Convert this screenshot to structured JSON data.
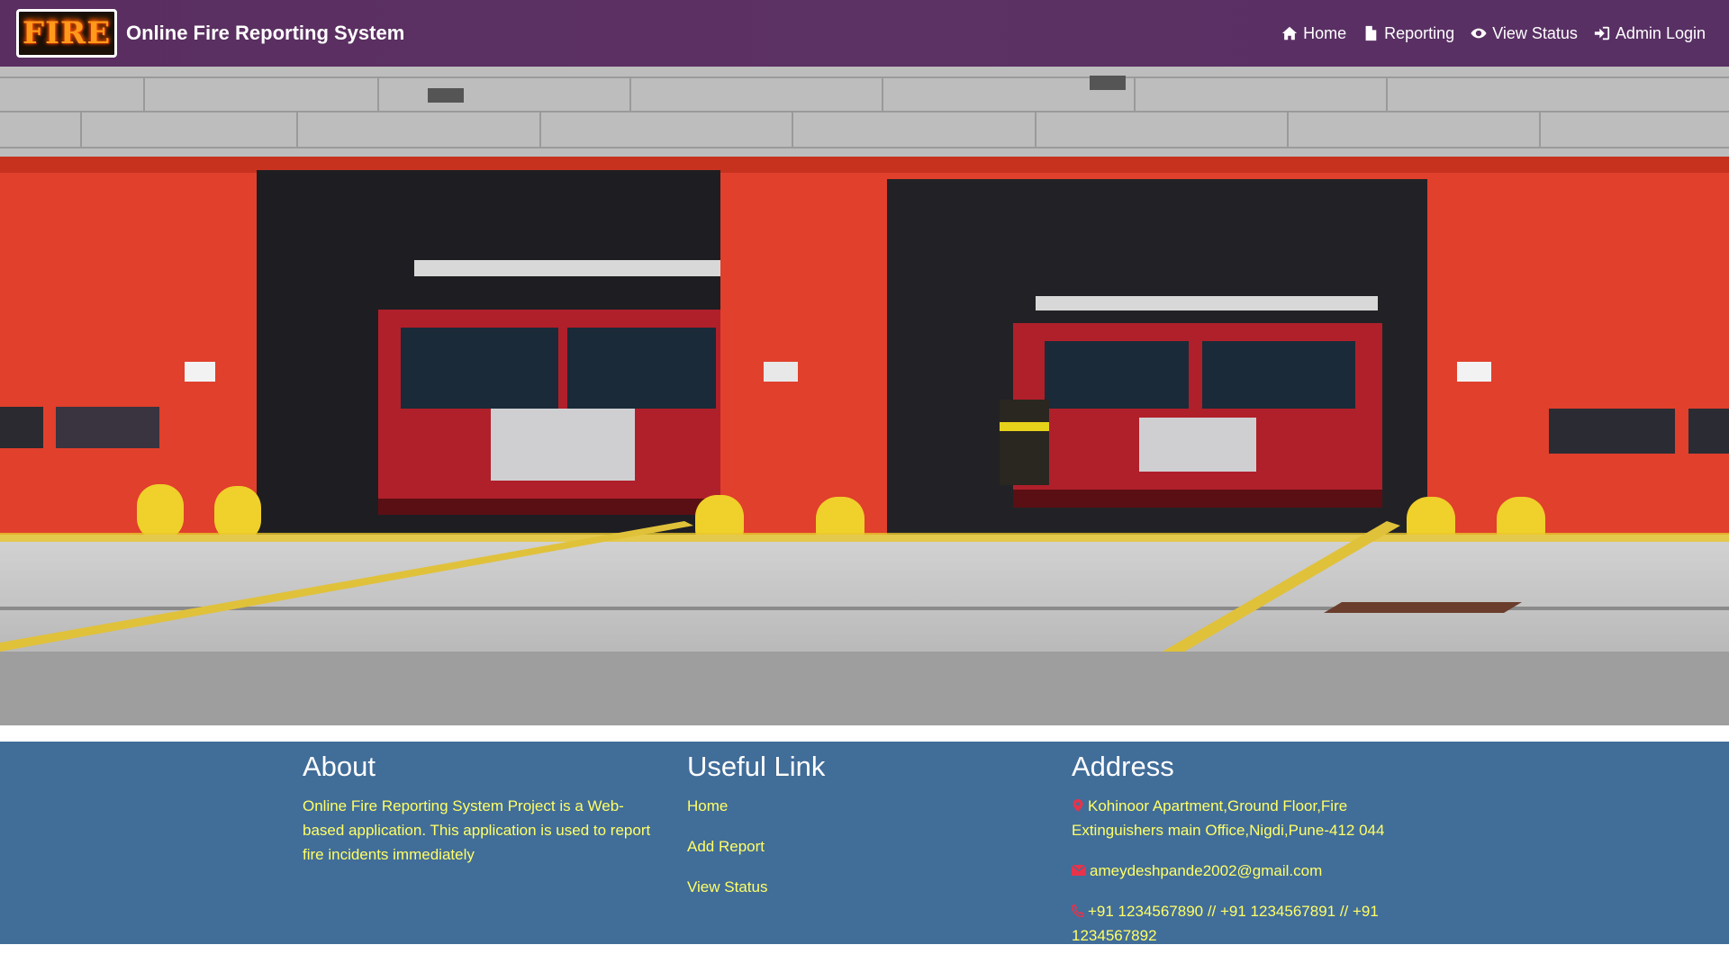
{
  "header": {
    "logo_text": "FIRE",
    "title": "Online Fire Reporting System",
    "nav": [
      {
        "label": "Home",
        "icon": "home-icon"
      },
      {
        "label": "Reporting",
        "icon": "file-icon"
      },
      {
        "label": "View Status",
        "icon": "eye-icon"
      },
      {
        "label": "Admin Login",
        "icon": "sign-in-icon"
      }
    ]
  },
  "hero": {
    "image": "fire-station-with-two-fire-trucks"
  },
  "footer": {
    "about": {
      "heading": "About",
      "text": "Online Fire Reporting System Project is a Web-based application. This application is used to report fire incidents immediately"
    },
    "links": {
      "heading": "Useful Link",
      "items": [
        "Home",
        "Add Report",
        "View Status"
      ]
    },
    "address": {
      "heading": "Address",
      "location": "Kohinoor Apartment,Ground Floor,Fire Extinguishers main Office,Nigdi,Pune-412 044",
      "email": "ameydeshpande2002@gmail.com",
      "phone": "+91 1234567890 // +91 1234567891 // +91 1234567892"
    }
  },
  "colors": {
    "navbar": "#5a2e60",
    "footer": "#416d99",
    "footer_text": "#ffff66",
    "icon_red": "#e8334a"
  }
}
